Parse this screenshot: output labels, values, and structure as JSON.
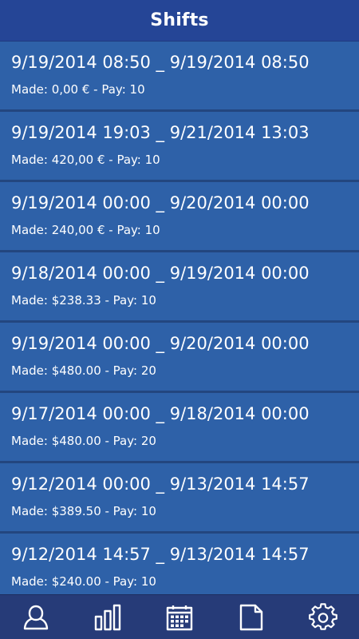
{
  "header": {
    "title": "Shifts"
  },
  "shifts": [
    {
      "range": "9/19/2014 08:50 _ 9/19/2014 08:50",
      "summary": "Made: 0,00 € - Pay: 10"
    },
    {
      "range": "9/19/2014 19:03 _ 9/21/2014 13:03",
      "summary": "Made: 420,00 € - Pay: 10"
    },
    {
      "range": "9/19/2014 00:00 _ 9/20/2014 00:00",
      "summary": "Made: 240,00 € - Pay: 10"
    },
    {
      "range": "9/18/2014 00:00 _ 9/19/2014 00:00",
      "summary": "Made: $238.33 - Pay: 10"
    },
    {
      "range": "9/19/2014 00:00 _ 9/20/2014 00:00",
      "summary": "Made: $480.00 - Pay: 20"
    },
    {
      "range": "9/17/2014 00:00 _ 9/18/2014 00:00",
      "summary": "Made: $480.00 - Pay: 20"
    },
    {
      "range": "9/12/2014 00:00 _ 9/13/2014 14:57",
      "summary": "Made: $389.50 - Pay: 10"
    },
    {
      "range": "9/12/2014 14:57 _ 9/13/2014 14:57",
      "summary": "Made: $240.00 - Pay: 10"
    }
  ],
  "tabbar": {
    "tabs": [
      {
        "icon": "profile-icon"
      },
      {
        "icon": "bar-chart-icon"
      },
      {
        "icon": "calendar-icon"
      },
      {
        "icon": "document-icon"
      },
      {
        "icon": "settings-gear-icon"
      }
    ]
  },
  "colors": {
    "header_bg": "#254596",
    "list_bg": "#2e61a8",
    "separator": "#23467f",
    "tabbar_bg": "#263b78",
    "text": "#ffffff"
  }
}
